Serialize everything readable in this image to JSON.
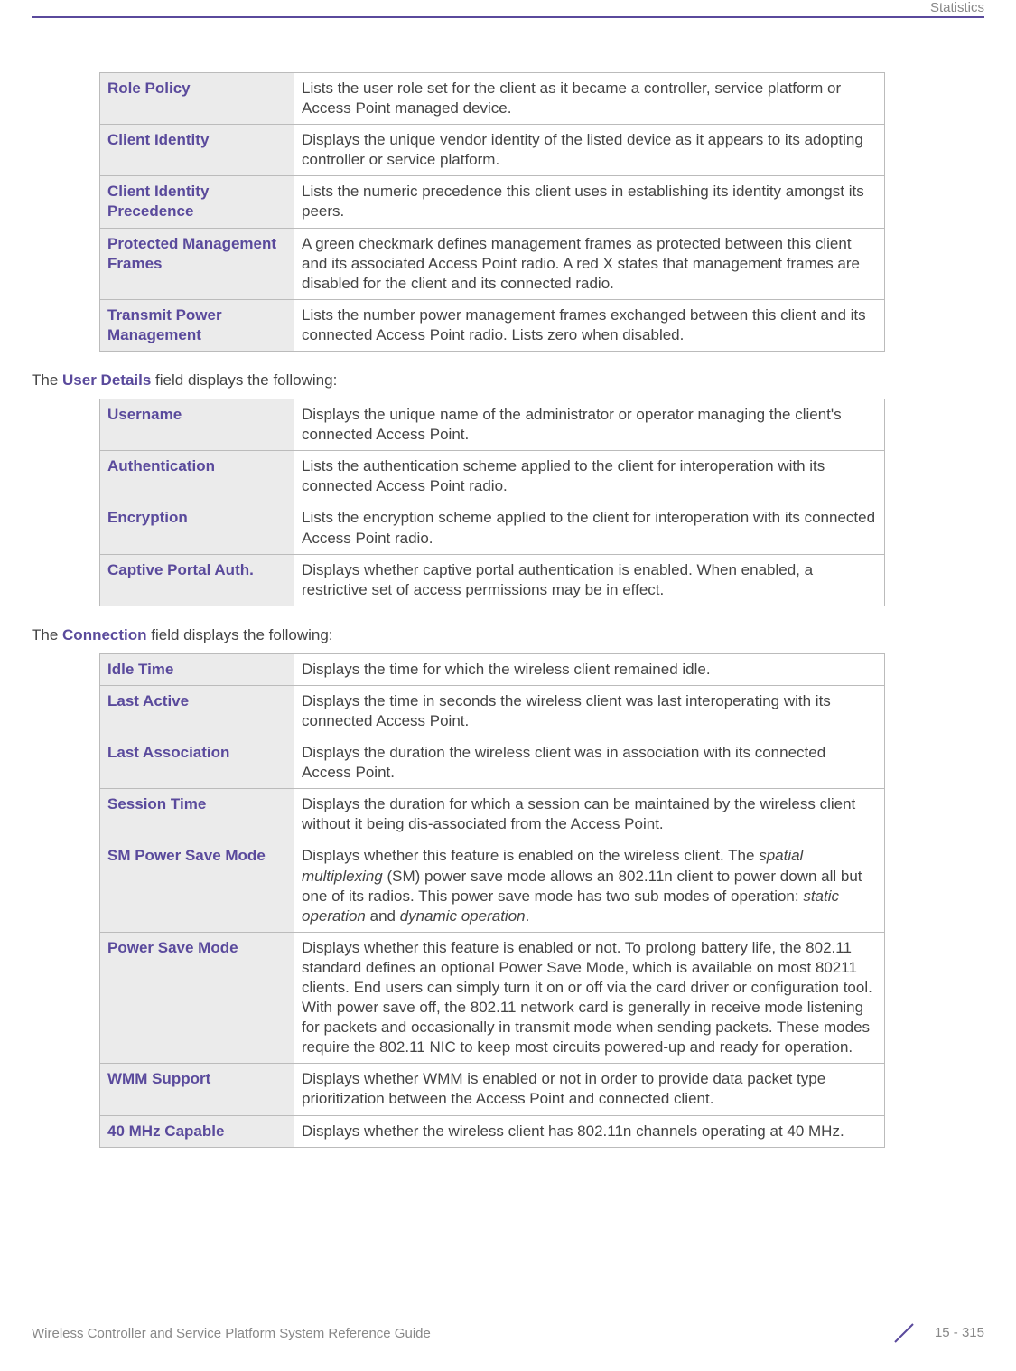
{
  "header": {
    "label": "Statistics"
  },
  "footer": {
    "left": "Wireless Controller and Service Platform System Reference Guide",
    "right": "15 - 315"
  },
  "table1": {
    "rows": [
      {
        "term": "Role Policy",
        "desc": "Lists the user role set for the client as it became a controller, service platform or Access Point managed device."
      },
      {
        "term": "Client Identity",
        "desc": "Displays the unique vendor identity of the listed device as it appears to its adopting controller or service platform."
      },
      {
        "term": "Client Identity Precedence",
        "desc": "Lists the numeric precedence this client uses in establishing its identity amongst its peers."
      },
      {
        "term": "Protected Management Frames",
        "desc": "A green checkmark defines management frames as protected between this client and its associated Access Point radio. A red X states that management frames are disabled for the client and its connected radio."
      },
      {
        "term": "Transmit Power Management",
        "desc": "Lists the number power management frames exchanged between this client and its connected Access Point radio. Lists zero when disabled."
      }
    ]
  },
  "section1": {
    "prefix": "The ",
    "bold": "User Details",
    "suffix": " field displays the following:"
  },
  "table2": {
    "rows": [
      {
        "term": "Username",
        "desc": "Displays the unique name of the administrator or operator managing the client's connected Access Point."
      },
      {
        "term": "Authentication",
        "desc": "Lists the authentication scheme applied to the client for interoperation with its connected Access Point radio."
      },
      {
        "term": "Encryption",
        "desc": "Lists the encryption scheme applied to the client for interoperation with its connected Access Point radio."
      },
      {
        "term": "Captive Portal Auth.",
        "desc": "Displays whether captive portal authentication is enabled. When enabled, a restrictive set of access permissions may be in effect."
      }
    ]
  },
  "section2": {
    "prefix": "The ",
    "bold": "Connection",
    "suffix": " field displays the following:"
  },
  "table3": {
    "rows": [
      {
        "term": "Idle Time",
        "desc": "Displays the time for which the wireless client remained idle."
      },
      {
        "term": "Last Active",
        "desc": "Displays the time in seconds the wireless client was last interoperating with its connected Access Point."
      },
      {
        "term": "Last Association",
        "desc": "Displays the duration the wireless client was in association with its connected Access Point."
      },
      {
        "term": "Session Time",
        "desc": "Displays the duration for which a session can be maintained by the wireless client without it being dis-associated from the Access Point."
      },
      {
        "term": "SM Power Save Mode",
        "desc_html": "Displays whether this feature is enabled on the wireless client. The <span class=\"italic\">spatial multiplexing</span> (SM) power save mode allows an 802.11n client to power down all but one of its radios. This power save mode has two sub modes of operation: <span class=\"italic\">static operation</span> and <span class=\"italic\">dynamic operation</span>."
      },
      {
        "term": "Power Save Mode",
        "desc": "Displays whether this feature is enabled or not. To prolong battery life, the 802.11 standard defines an optional Power Save Mode, which is available on most 80211 clients. End users can simply turn it on or off via the card driver or configuration tool. With power save off, the 802.11 network card is generally in receive mode listening for packets and occasionally in transmit mode when sending packets. These modes require the 802.11 NIC to keep most circuits powered-up and ready for operation."
      },
      {
        "term": "WMM Support",
        "desc": "Displays whether WMM is enabled or not in order to provide data packet type prioritization between the Access Point and connected client."
      },
      {
        "term": "40 MHz Capable",
        "desc": "Displays whether the wireless client has 802.11n channels operating at 40 MHz."
      }
    ]
  }
}
